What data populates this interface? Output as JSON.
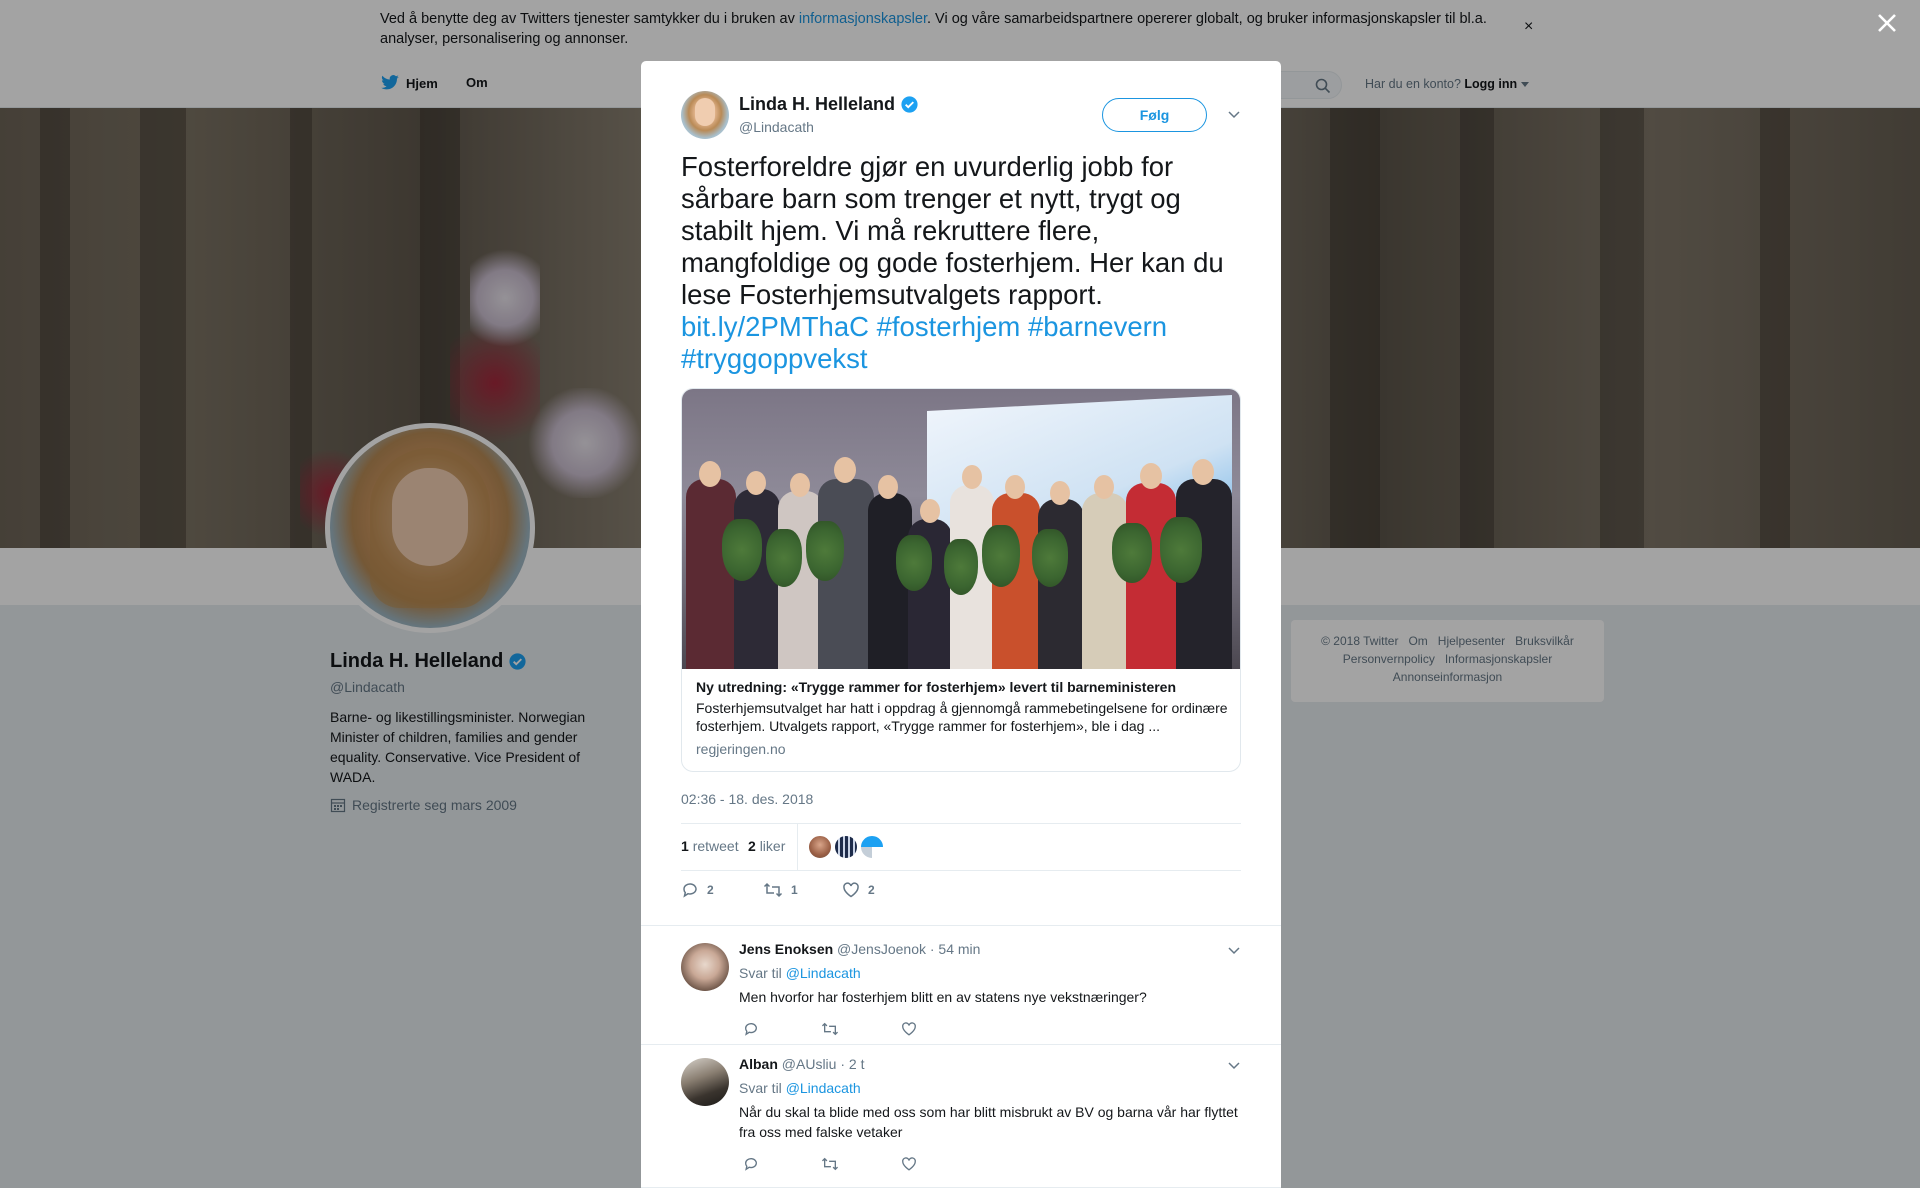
{
  "cookie": {
    "text_before": "Ved å benytte deg av Twitters tjenester samtykker du i bruken av ",
    "link": "informasjonskapsler",
    "text_after": ". Vi og våre samarbeidspartnere opererer globalt, og bruker informasjonskapsler til bl.a. analyser, personalisering og annonser.",
    "close": "×"
  },
  "nav": {
    "home": "Hjem",
    "about": "Om",
    "account_prompt": "Har du en konto?",
    "login": "Logg inn"
  },
  "profile": {
    "name": "Linda H. Helleland",
    "handle": "@Lindacath",
    "bio": "Barne- og likestillingsminister. Norwegian Minister of children, families and gender equality. Conservative. Vice President of WADA.",
    "joined": "Registrerte seg mars 2009"
  },
  "footer": {
    "links": [
      "© 2018 Twitter",
      "Om",
      "Hjelpesenter",
      "Bruksvilkår",
      "Personvernpolicy",
      "Informasjonskapsler",
      "Annonseinformasjon"
    ]
  },
  "tweet": {
    "author_name": "Linda H. Helleland",
    "author_handle": "@Lindacath",
    "follow_label": "Følg",
    "text": "Fosterforeldre gjør en uvurderlig jobb for sårbare barn som trenger et nytt, trygt og stabilt hjem. Vi må rekruttere flere, mangfoldige og gode fosterhjem. Her kan du lese Fosterhjemsutvalgets rapport.",
    "link": "bit.ly/2PMThaC",
    "hashtags": [
      "#fosterhjem",
      "#barnevern",
      "#tryggoppvekst"
    ],
    "card": {
      "title": "Ny utredning: «Trygge rammer for fosterhjem» levert til barneministeren",
      "description": "Fosterhjemsutvalget har hatt i oppdrag å gjennomgå rammebetingelsene for ordinære fosterhjem. Utvalgets rapport, «Trygge rammer for fosterhjem», ble i dag ...",
      "domain": "regjeringen.no"
    },
    "timestamp": "02:36 - 18. des. 2018",
    "retweets_count": "1",
    "retweets_label": "retweet",
    "likes_count": "2",
    "likes_label": "liker",
    "reply_count": "2",
    "retweet_count_action": "1",
    "like_count_action": "2"
  },
  "replies": [
    {
      "name": "Jens Enoksen",
      "handle": "@JensJoenok",
      "time": "· 54 min",
      "reply_to_label": "Svar til",
      "reply_to": "@Lindacath",
      "text": "Men hvorfor har fosterhjem blitt en av statens nye vekstnæringer?"
    },
    {
      "name": "Alban",
      "handle": "@AUsliu",
      "time": "· 2 t",
      "reply_to_label": "Svar til",
      "reply_to": "@Lindacath",
      "text": "Når du skal ta blide med oss som har blitt misbrukt av BV og barna vår har flyttet fra oss med falske vetaker"
    }
  ],
  "colors": {
    "brand_blue": "#1b95e0",
    "text_dark": "#14171a",
    "text_gray": "#657786"
  }
}
